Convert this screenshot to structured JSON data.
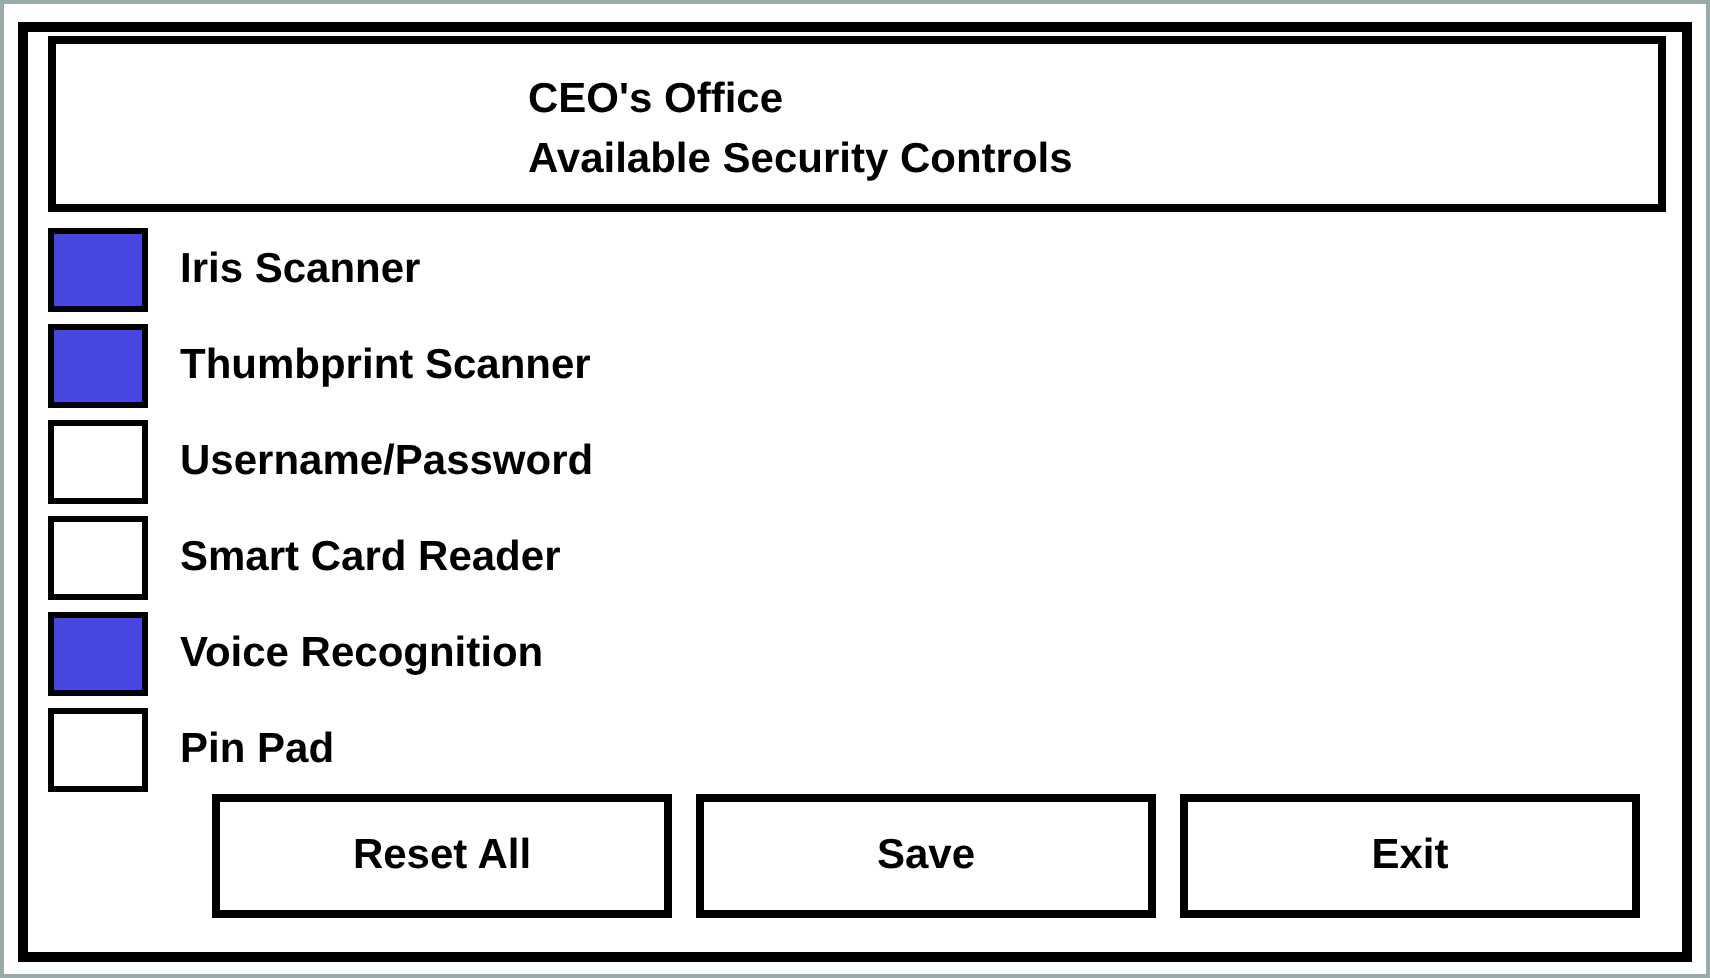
{
  "header": {
    "lines": [
      "CEO's Office",
      "Available Security Controls"
    ]
  },
  "controls": [
    {
      "label": "Iris Scanner",
      "checked": true
    },
    {
      "label": "Thumbprint Scanner",
      "checked": true
    },
    {
      "label": "Username/Password",
      "checked": false
    },
    {
      "label": "Smart Card Reader",
      "checked": false
    },
    {
      "label": "Voice Recognition",
      "checked": true
    },
    {
      "label": "Pin Pad",
      "checked": false
    }
  ],
  "buttons": [
    "Reset All",
    "Save",
    "Exit"
  ]
}
